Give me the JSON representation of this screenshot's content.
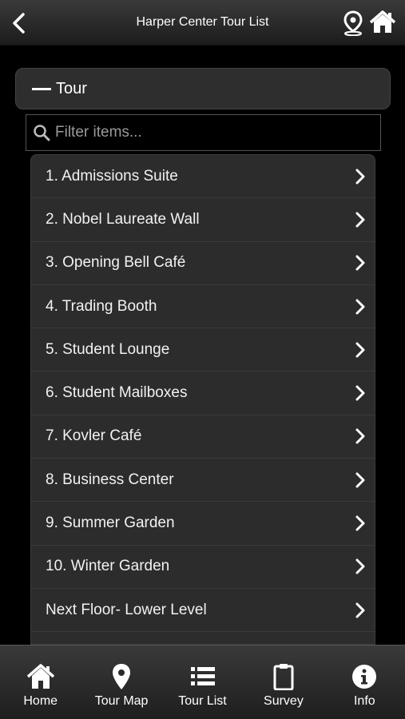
{
  "header": {
    "title": "Harper Center Tour List",
    "back_icon": "chevron-left-icon",
    "location_icon": "map-pin-icon",
    "home_icon": "home-icon"
  },
  "section": {
    "label": "Tour",
    "state_icon": "minus-icon"
  },
  "filter": {
    "placeholder": "Filter items...",
    "value": ""
  },
  "items": [
    {
      "label": "1. Admissions Suite"
    },
    {
      "label": "2. Nobel Laureate Wall"
    },
    {
      "label": "3. Opening Bell Café"
    },
    {
      "label": "4. Trading Booth"
    },
    {
      "label": "5. Student Lounge"
    },
    {
      "label": "6. Student Mailboxes"
    },
    {
      "label": "7. Kovler Café"
    },
    {
      "label": "8. Business Center"
    },
    {
      "label": "9. Summer Garden"
    },
    {
      "label": "10. Winter Garden"
    },
    {
      "label": "Next Floor- Lower Level"
    }
  ],
  "tabs": [
    {
      "label": "Home",
      "icon": "home-icon"
    },
    {
      "label": "Tour Map",
      "icon": "map-pin-icon"
    },
    {
      "label": "Tour List",
      "icon": "list-icon"
    },
    {
      "label": "Survey",
      "icon": "clipboard-icon"
    },
    {
      "label": "Info",
      "icon": "info-icon"
    }
  ],
  "colors": {
    "background": "#000000",
    "list_bg": "#2c2c2c",
    "text": "#ffffff"
  }
}
